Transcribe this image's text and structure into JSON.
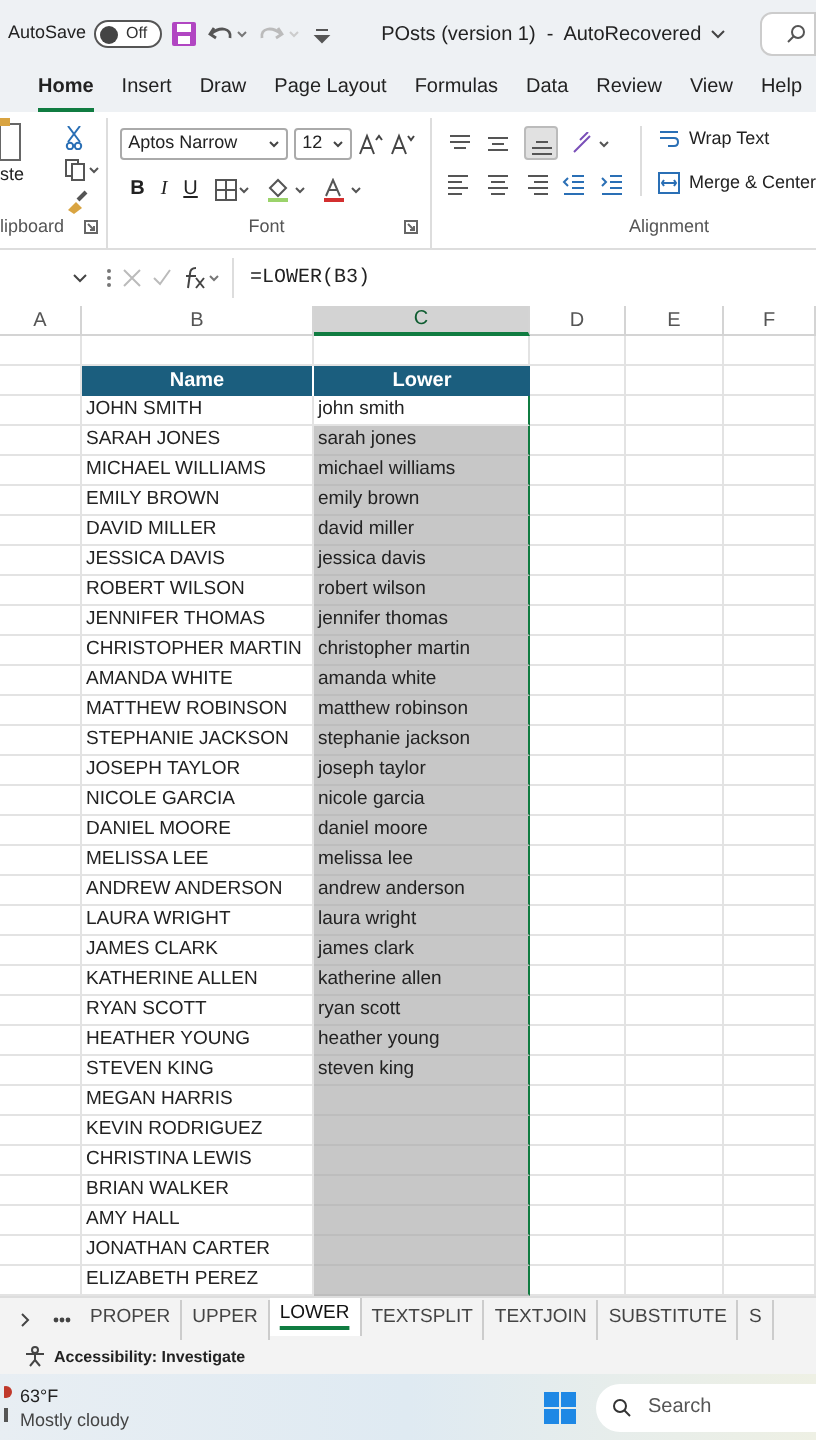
{
  "title_bar": {
    "autosave_label": "AutoSave",
    "autosave": {
      "label": "Off",
      "on": false
    },
    "title": "POsts (version 1)  -  AutoRecovered"
  },
  "tabs": [
    {
      "label": "Home",
      "selected": true
    },
    {
      "label": "Insert",
      "selected": false
    },
    {
      "label": "Draw",
      "selected": false
    },
    {
      "label": "Page Layout",
      "selected": false
    },
    {
      "label": "Formulas",
      "selected": false
    },
    {
      "label": "Data",
      "selected": false
    },
    {
      "label": "Review",
      "selected": false
    },
    {
      "label": "View",
      "selected": false
    },
    {
      "label": "Help",
      "selected": false
    }
  ],
  "ribbon": {
    "paste_label": "ste",
    "font_name": "Aptos Narrow",
    "font_size": "12",
    "bold": "B",
    "italic": "I",
    "underline": "U",
    "wrap_text": "Wrap Text",
    "merge_center": "Merge & Center",
    "groups": [
      "lipboard",
      "Font",
      "Alignment"
    ]
  },
  "formula_bar": {
    "formula": "=LOWER(B3)"
  },
  "columns": [
    {
      "label": "A",
      "selected": false
    },
    {
      "label": "B",
      "selected": false
    },
    {
      "label": "C",
      "selected": true
    },
    {
      "label": "D",
      "selected": false
    },
    {
      "label": "E",
      "selected": false
    },
    {
      "label": "F",
      "selected": false
    }
  ],
  "table": {
    "columns": [
      "Name",
      "Lower"
    ],
    "rows": [
      {
        "name": "JOHN SMITH",
        "lower": "john smith"
      },
      {
        "name": "SARAH JONES",
        "lower": "sarah jones"
      },
      {
        "name": "MICHAEL WILLIAMS",
        "lower": "michael williams"
      },
      {
        "name": "EMILY BROWN",
        "lower": "emily brown"
      },
      {
        "name": "DAVID MILLER",
        "lower": "david miller"
      },
      {
        "name": "JESSICA DAVIS",
        "lower": "jessica davis"
      },
      {
        "name": "ROBERT WILSON",
        "lower": "robert wilson"
      },
      {
        "name": "JENNIFER THOMAS",
        "lower": "jennifer thomas"
      },
      {
        "name": "CHRISTOPHER MARTIN",
        "lower": "christopher martin"
      },
      {
        "name": "AMANDA WHITE",
        "lower": "amanda white"
      },
      {
        "name": "MATTHEW ROBINSON",
        "lower": "matthew robinson"
      },
      {
        "name": "STEPHANIE JACKSON",
        "lower": "stephanie jackson"
      },
      {
        "name": "JOSEPH TAYLOR",
        "lower": "joseph taylor"
      },
      {
        "name": "NICOLE GARCIA",
        "lower": "nicole garcia"
      },
      {
        "name": "DANIEL MOORE",
        "lower": "daniel moore"
      },
      {
        "name": "MELISSA LEE",
        "lower": "melissa lee"
      },
      {
        "name": "ANDREW ANDERSON",
        "lower": "andrew anderson"
      },
      {
        "name": "LAURA WRIGHT",
        "lower": "laura wright"
      },
      {
        "name": "JAMES CLARK",
        "lower": "james clark"
      },
      {
        "name": "KATHERINE ALLEN",
        "lower": "katherine allen"
      },
      {
        "name": "RYAN SCOTT",
        "lower": "ryan scott"
      },
      {
        "name": "HEATHER YOUNG",
        "lower": "heather young"
      },
      {
        "name": "STEVEN KING",
        "lower": "steven king"
      },
      {
        "name": "MEGAN HARRIS"
      },
      {
        "name": "KEVIN RODRIGUEZ"
      },
      {
        "name": "CHRISTINA LEWIS"
      },
      {
        "name": "BRIAN WALKER"
      },
      {
        "name": "AMY HALL"
      },
      {
        "name": "JONATHAN CARTER"
      },
      {
        "name": "ELIZABETH PEREZ"
      }
    ]
  },
  "sheet_tabs": [
    {
      "label": "PROPER",
      "selected": false
    },
    {
      "label": "UPPER",
      "selected": false
    },
    {
      "label": "LOWER",
      "selected": true
    },
    {
      "label": "TEXTSPLIT",
      "selected": false
    },
    {
      "label": "TEXTJOIN",
      "selected": false
    },
    {
      "label": "SUBSTITUTE",
      "selected": false
    },
    {
      "label": "S",
      "selected": false
    }
  ],
  "status_bar": {
    "accessibility": "Accessibility: Investigate"
  },
  "taskbar": {
    "temperature": "63°F",
    "weather": "Mostly cloudy",
    "search_placeholder": "Search"
  }
}
